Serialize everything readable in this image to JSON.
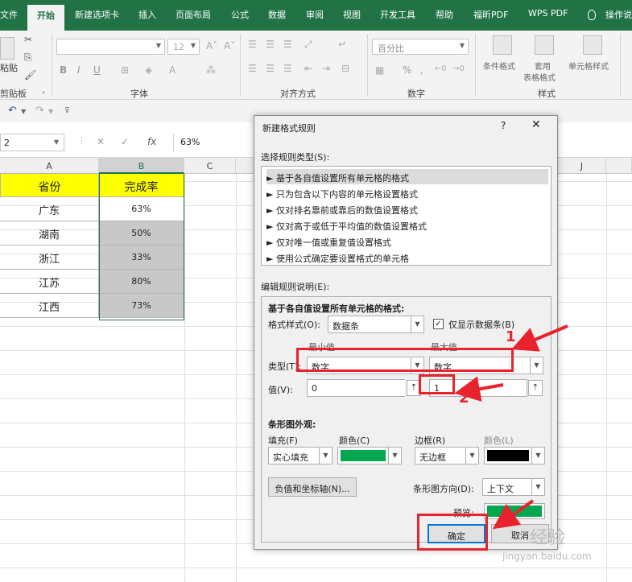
{
  "tabs": [
    "文件",
    "开始",
    "新建选项卡",
    "插入",
    "页面布局",
    "公式",
    "数据",
    "审阅",
    "视图",
    "开发工具",
    "帮助",
    "福昕PDF",
    "WPS PDF",
    "操作说"
  ],
  "ribbon": {
    "clipboard": {
      "label": "剪贴板",
      "paste": "粘贴"
    },
    "font": {
      "label": "字体",
      "size": "12",
      "bold": "B",
      "italic": "I",
      "underline": "U"
    },
    "alignment": {
      "label": "对齐方式"
    },
    "number": {
      "label": "数字",
      "format": "百分比"
    },
    "styles": {
      "label": "样式",
      "conditional": "条件格式",
      "table_a": "套用",
      "table_b": "表格格式",
      "cell_styles": "单元格样式"
    }
  },
  "formula_bar": {
    "name_box": "2",
    "fx": "fx",
    "value": "63%"
  },
  "grid": {
    "columns": [
      "A",
      "B",
      "C",
      "J"
    ],
    "header_row": [
      "省份",
      "完成率"
    ],
    "rows": [
      {
        "province": "广东",
        "rate": "63%"
      },
      {
        "province": "湖南",
        "rate": "50%"
      },
      {
        "province": "浙江",
        "rate": "33%"
      },
      {
        "province": "江苏",
        "rate": "80%"
      },
      {
        "province": "江西",
        "rate": "73%"
      }
    ]
  },
  "dialog": {
    "title": "新建格式规则",
    "help": "?",
    "close": "✕",
    "rule_type_label": "选择规则类型(S):",
    "rule_types": [
      "► 基于各自值设置所有单元格的格式",
      "► 只为包含以下内容的单元格设置格式",
      "► 仅对排名靠前或靠后的数值设置格式",
      "► 仅对高于或低于平均值的数值设置格式",
      "► 仅对唯一值或重复值设置格式",
      "► 使用公式确定要设置格式的单元格"
    ],
    "edit_label": "编辑规则说明(E):",
    "edit_title": "基于各自值设置所有单元格的格式:",
    "format_style_label": "格式样式(O):",
    "format_style": "数据条",
    "show_bar_only": "仅显示数据条(B)",
    "min_label": "最小值",
    "max_label": "最大值",
    "type_label": "类型(T):",
    "type_min": "数字",
    "type_max": "数字",
    "value_label": "值(V):",
    "value_min": "0",
    "value_max": "1",
    "bar_appearance": "条形图外观:",
    "fill_label": "填充(F)",
    "fill_value": "实心填充",
    "color_label": "颜色(C)",
    "fill_color": "#00a650",
    "border_label": "边框(R)",
    "border_value": "无边框",
    "border_color_label": "颜色(L)",
    "border_color": "#000000",
    "neg_axis_button": "负值和坐标轴(N)...",
    "direction_label": "条形图方向(D):",
    "direction_value": "上下文",
    "preview_label": "预览:",
    "ok": "确定",
    "cancel": "取消"
  },
  "annotations": [
    "1",
    "2"
  ],
  "watermark": {
    "text": "经验",
    "url": "jingyan.baidu.com"
  },
  "colors": {
    "excel_green": "#217346",
    "header_yellow": "#ffff00",
    "annotation_red": "#e8232d"
  }
}
